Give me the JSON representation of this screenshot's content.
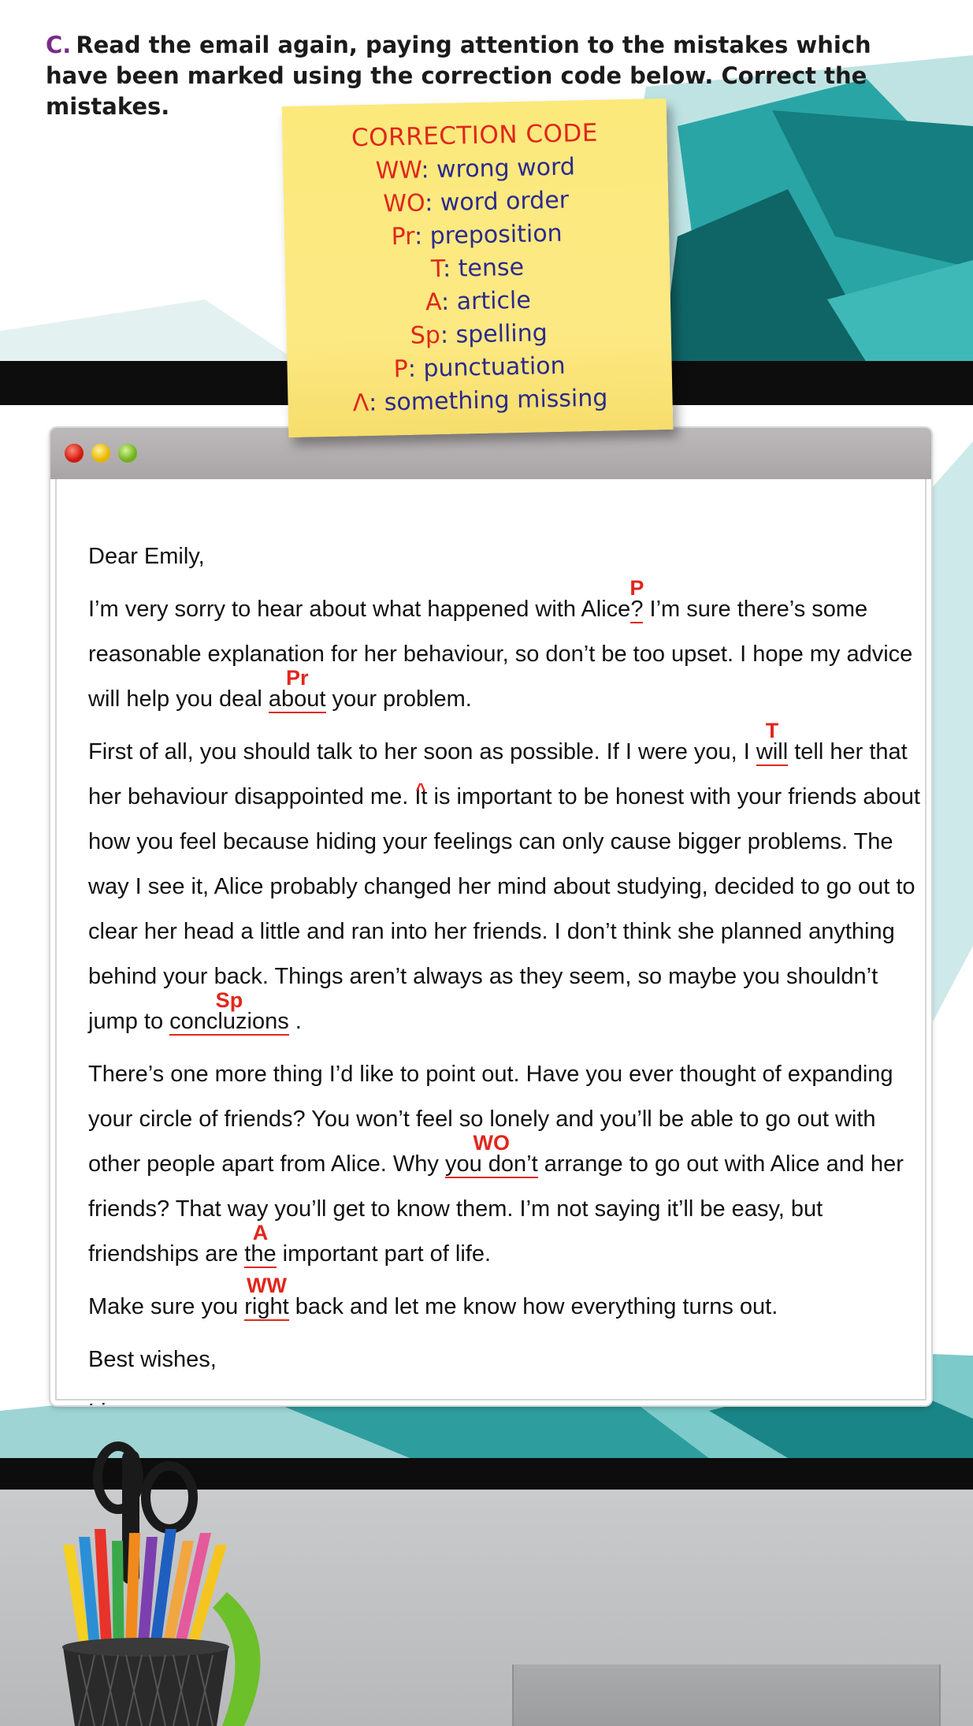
{
  "instruction": {
    "letter": "C.",
    "text": "Read the email again, paying attention to the mistakes which have been marked using the correction code below. Correct the mistakes."
  },
  "correction_code": {
    "title": "CORRECTION CODE",
    "items": [
      {
        "code": "WW",
        "meaning": "wrong word"
      },
      {
        "code": "WO",
        "meaning": "word order"
      },
      {
        "code": "Pr",
        "meaning": "preposition"
      },
      {
        "code": "T",
        "meaning": "tense"
      },
      {
        "code": "A",
        "meaning": "article"
      },
      {
        "code": "Sp",
        "meaning": "spelling"
      },
      {
        "code": "P",
        "meaning": "punctuation"
      },
      {
        "code": "Λ",
        "meaning": "something missing"
      }
    ]
  },
  "email": {
    "greeting": "Dear Emily,",
    "p1": {
      "a": "I’m very sorry to hear about what happened with Alice",
      "m1": "?",
      "m1_code": "P",
      "b": " I’m sure there’s some reasonable explanation for her behaviour, so don’t be too upset. I hope my advice will help you deal ",
      "m2": "about",
      "m2_code": "Pr",
      "c": " your problem."
    },
    "p2": {
      "a": "First of all, you should talk to her",
      "caret": "^",
      "b": " soon as possible. If I were you, I ",
      "m1": "will",
      "m1_code": "T",
      "c": " tell her that her behaviour disappointed me. It is important to be honest with your friends about how you feel because hiding your feelings can only cause bigger problems. The way I see it, Alice probably changed her mind about studying, decided to go out to clear her head a little and ran into her friends. I don’t think she planned anything behind your back. Things aren’t always as they seem, so maybe you shouldn’t jump to ",
      "m2": "concluzions",
      "m2_code": "Sp",
      "d": " ."
    },
    "p3": {
      "a": "There’s one more thing I’d like to point out. Have you ever thought of expanding your circle of friends? You won’t feel so lonely and you’ll be able to go out with other people apart from Alice. Why ",
      "m1": "you don’t",
      "m1_code": "WO",
      "b": " arrange to go out with Alice and her friends? That way you’ll get to know them. I’m not saying it’ll be easy, but friendships are ",
      "m2": "the",
      "m2_code": "A",
      "c": " important part of life."
    },
    "p4": {
      "a": "Make sure you ",
      "m1": "right",
      "m1_code": "WW",
      "b": " back and let me know how everything turns out."
    },
    "closing": "Best wishes,",
    "signature": "Lisa"
  },
  "colors": {
    "correction_red": "#e1261c",
    "note_blue": "#2c2a8c",
    "note_yellow": "#fde983",
    "teal": "#1f9a9a"
  }
}
